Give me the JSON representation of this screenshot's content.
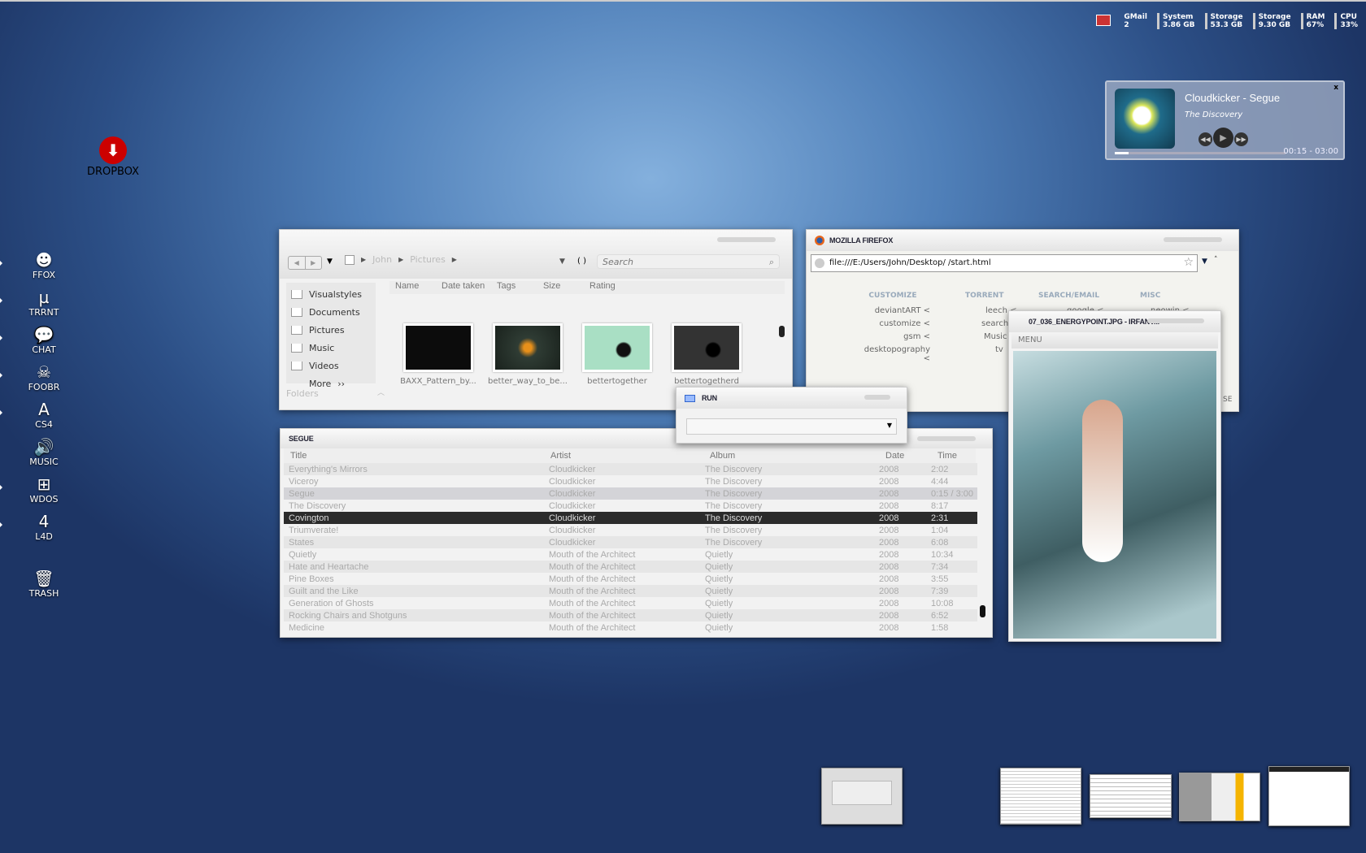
{
  "tray": [
    {
      "label": "GMail",
      "value": "2"
    },
    {
      "label": "System",
      "value": "3.86 GB"
    },
    {
      "label": "Storage",
      "value": "53.3 GB"
    },
    {
      "label": "Storage",
      "value": "9.30 GB"
    },
    {
      "label": "RAM",
      "value": "67%"
    },
    {
      "label": "CPU",
      "value": "33%"
    }
  ],
  "player": {
    "title": "Cloudkicker - Segue",
    "album": "The Discovery",
    "time": "00:15 - 03:00",
    "progress": 0.083,
    "close": "x"
  },
  "desktop": {
    "dropbox": "DROPBOX",
    "dock": [
      {
        "label": "FFOX",
        "icon": "firefox-icon",
        "glyph": "☻"
      },
      {
        "label": "TRRNT",
        "icon": "utorrent-icon",
        "glyph": "µ"
      },
      {
        "label": "CHAT",
        "icon": "chat-icon",
        "glyph": "💬"
      },
      {
        "label": "FOOBR",
        "icon": "foobar-icon",
        "glyph": "☠"
      },
      {
        "label": "CS4",
        "icon": "adobe-icon",
        "glyph": "A"
      },
      {
        "label": "MUSIC",
        "icon": "speaker-icon",
        "glyph": "🔊"
      },
      {
        "label": "WDOS",
        "icon": "windows-icon",
        "glyph": "⊞"
      },
      {
        "label": "L4D",
        "icon": "l4d-icon",
        "glyph": "4"
      }
    ],
    "trash": "TRASH"
  },
  "explorer": {
    "breadcrumb": [
      "John",
      "Pictures"
    ],
    "search_placeholder": "Search",
    "sidebar": [
      "Visualstyles",
      "Documents",
      "Pictures",
      "Music",
      "Videos"
    ],
    "more": "More",
    "folders": "Folders",
    "columns": [
      "Name",
      "Date taken",
      "Tags",
      "Size",
      "Rating"
    ],
    "files": [
      "BAXX_Pattern_by...",
      "better_way_to_be...",
      "bettertogether",
      "bettertogetherd"
    ]
  },
  "firefox": {
    "title": "MOZILLA FIREFOX",
    "url": "file:///E:/Users/John/Desktop/  /start.html",
    "columns": [
      {
        "head": "CUSTOMIZE",
        "links": [
          "deviantART <",
          "customize <",
          "gsm <",
          "desktopography <"
        ]
      },
      {
        "head": "TORRENT",
        "links": [
          "leech <",
          "search",
          "Music",
          "tv"
        ]
      },
      {
        "head": "SEARCH/EMAIL",
        "links": [
          "google <"
        ]
      },
      {
        "head": "MISC",
        "links": [
          "neowin <"
        ]
      }
    ],
    "partial": "SE"
  },
  "run": {
    "title": "RUN",
    "value": ""
  },
  "irfan": {
    "title": "07_036_ENERGYPOINT.JPG - IRFANV...",
    "menu": "MENU"
  },
  "playlist": {
    "title": "SEGUE",
    "columns": [
      "Title",
      "Artist",
      "Album",
      "Date",
      "Time"
    ],
    "rows": [
      [
        "Everything's Mirrors",
        "Cloudkicker",
        "The Discovery",
        "2008",
        "2:02"
      ],
      [
        "Viceroy",
        "Cloudkicker",
        "The Discovery",
        "2008",
        "4:44"
      ],
      [
        "Segue",
        "Cloudkicker",
        "The Discovery",
        "2008",
        "0:15 / 3:00"
      ],
      [
        "The Discovery",
        "Cloudkicker",
        "The Discovery",
        "2008",
        "8:17"
      ],
      [
        "Covington",
        "Cloudkicker",
        "The Discovery",
        "2008",
        "2:31"
      ],
      [
        "Triumverate!",
        "Cloudkicker",
        "The Discovery",
        "2008",
        "1:04"
      ],
      [
        "States",
        "Cloudkicker",
        "The Discovery",
        "2008",
        "6:08"
      ],
      [
        "Quietly",
        "Mouth of the Architect",
        "Quietly",
        "2008",
        "10:34"
      ],
      [
        "Hate and Heartache",
        "Mouth of the Architect",
        "Quietly",
        "2008",
        "7:34"
      ],
      [
        "Pine Boxes",
        "Mouth of the Architect",
        "Quietly",
        "2008",
        "3:55"
      ],
      [
        "Guilt and the Like",
        "Mouth of the Architect",
        "Quietly",
        "2008",
        "7:39"
      ],
      [
        "Generation of Ghosts",
        "Mouth of the Architect",
        "Quietly",
        "2008",
        "10:08"
      ],
      [
        "Rocking Chairs and Shotguns",
        "Mouth of the Architect",
        "Quietly",
        "2008",
        "6:52"
      ],
      [
        "Medicine",
        "Mouth of the Architect",
        "Quietly",
        "2008",
        "1:58"
      ]
    ],
    "playing_index": 2,
    "selected_index": 4
  }
}
